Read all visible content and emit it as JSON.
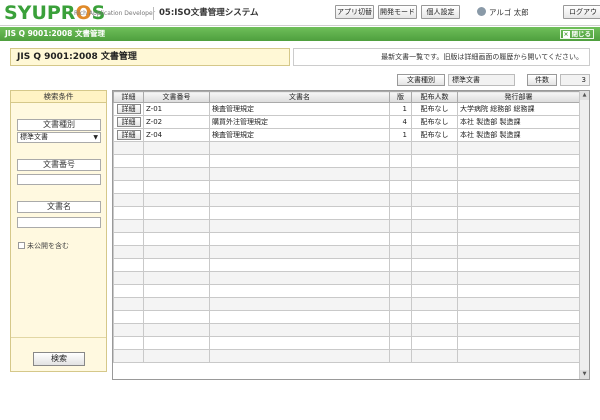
{
  "header": {
    "logo_main": "SYUPROS",
    "logo_sub": "Rich Application Developer",
    "system_name": "05:ISO文書管理システム",
    "buttons": [
      "アプリ切替",
      "開発モード",
      "個人設定"
    ],
    "user_name": "アルゴ 太郎",
    "logout_label": "ログアウ"
  },
  "window": {
    "title": "JIS Q 9001:2008 文書管理",
    "close_label": "閉じる",
    "close_icon": "close-icon"
  },
  "doc": {
    "title": "JIS Q 9001:2008 文書管理",
    "info": "最新文書一覧です。旧版は詳細画面の履歴から開いてください。"
  },
  "filter": {
    "type_label": "文書種別",
    "type_value": "標準文書",
    "count_label": "件数",
    "count_value": "3"
  },
  "search_panel": {
    "title": "検索条件",
    "doc_type_label": "文書種別",
    "doc_type_value": "標準文書",
    "doc_number_label": "文書番号",
    "doc_number_value": "",
    "doc_name_label": "文書名",
    "doc_name_value": "",
    "include_unpublished_label": "未公開を含む",
    "search_button": "検索"
  },
  "grid": {
    "columns": [
      "詳細",
      "文書番号",
      "文書名",
      "版",
      "配布人数",
      "発行部署"
    ],
    "detail_label": "詳細",
    "rows": [
      {
        "number": "Z-01",
        "name": "検査管理規定",
        "version": "1",
        "distribution": "配布なし",
        "department": "大学病院 総務部 総務課"
      },
      {
        "number": "Z-02",
        "name": "購買外注管理規定",
        "version": "4",
        "distribution": "配布なし",
        "department": "本社 製造部 製造課"
      },
      {
        "number": "Z-04",
        "name": "検査管理規定",
        "version": "1",
        "distribution": "配布なし",
        "department": "本社 製造部 製造課"
      }
    ]
  },
  "colors": {
    "brand_green": "#4e9f3e",
    "logo_accent": "#e08a2a",
    "panel_bg": "#fff9e0"
  }
}
